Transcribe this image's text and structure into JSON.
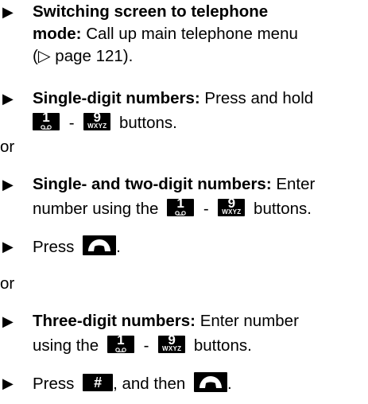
{
  "bullet_symbol": "▶",
  "items": [
    {
      "bold": "Switching screen to telephone",
      "bold2": "mode:",
      "rest": " Call up main telephone menu",
      "line3": "(▷ page 121)."
    },
    {
      "bold": "Single-digit numbers:",
      "rest": " Press and hold",
      "line2_after": "buttons."
    },
    {
      "bold": "Single- and two-digit numbers:",
      "rest": " Enter",
      "line2_before": "number using the",
      "line2_after": "buttons."
    },
    {
      "text": "Press"
    },
    {
      "bold": "Three-digit numbers:",
      "rest": " Enter number",
      "line2_before": "using the",
      "line2_after": "buttons."
    },
    {
      "text": "Press",
      "middle": ", and then"
    }
  ],
  "or_label": "or",
  "keys": {
    "one_digit": "1",
    "nine_digit": "9",
    "nine_letters": "WXYZ",
    "hash": "#",
    "dash": "-",
    "phone_icon": "phone-handset-icon",
    "voicemail_icon": "voicemail-icon"
  },
  "colors": {
    "text": "#000000",
    "key_background": "#000000",
    "key_text": "#ffffff",
    "page_background": "#ffffff"
  }
}
